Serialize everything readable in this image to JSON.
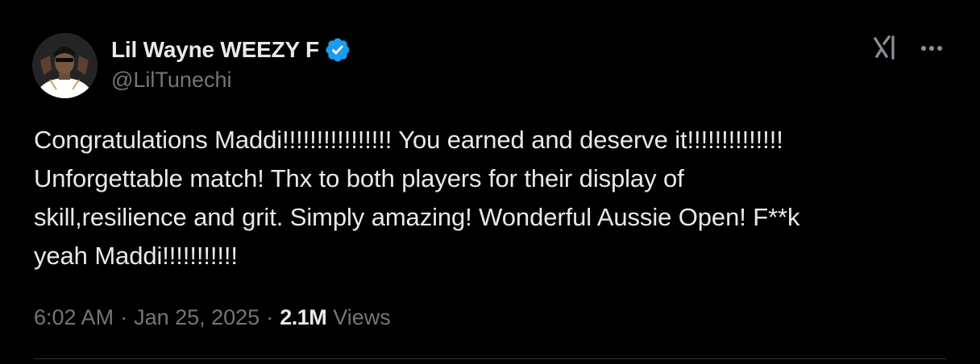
{
  "author": {
    "display_name": "Lil Wayne WEEZY F",
    "handle": "@LilTunechi",
    "verified": true,
    "verified_color": "#1d9bf0",
    "avatar_icon": "profile-photo"
  },
  "header_actions": {
    "grok_icon": "grok-icon",
    "more_icon": "more-horizontal-icon"
  },
  "tweet": {
    "text": "Congratulations Maddi!!!!!!!!!!!!!!!! You earned and deserve it!!!!!!!!!!!!!!\nUnforgettable match!  Thx to both players for their display of\nskill,resilience and grit. Simply amazing! Wonderful Aussie Open! F**k\nyeah Maddi!!!!!!!!!!!"
  },
  "meta": {
    "time": "6:02 AM",
    "separator": "·",
    "date": "Jan 25, 2025",
    "views_count": "2.1M",
    "views_label": "Views"
  },
  "colors": {
    "background": "#000000",
    "primary_text": "#e7e9ea",
    "secondary_text": "#71767b",
    "divider": "#2f3336"
  }
}
